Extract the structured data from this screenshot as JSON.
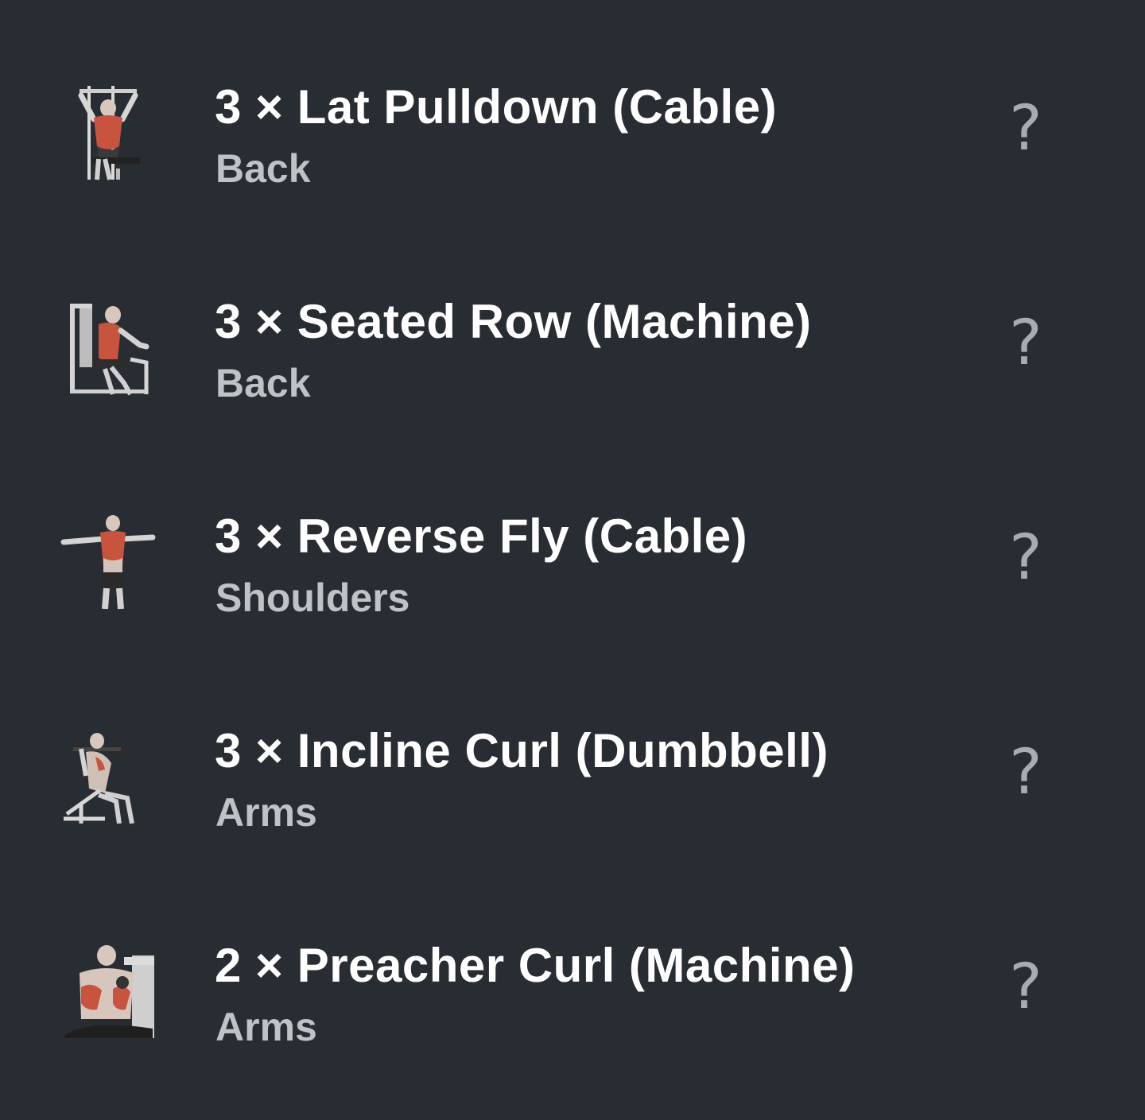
{
  "exercises": [
    {
      "title": "3 × Lat Pulldown (Cable)",
      "muscle": "Back",
      "help_icon": "question-mark",
      "help_glyph": "?"
    },
    {
      "title": "3 × Seated Row (Machine)",
      "muscle": "Back",
      "help_icon": "question-mark",
      "help_glyph": "?"
    },
    {
      "title": "3 × Reverse Fly (Cable)",
      "muscle": "Shoulders",
      "help_icon": "question-mark",
      "help_glyph": "?"
    },
    {
      "title": "3 × Incline Curl (Dumbbell)",
      "muscle": "Arms",
      "help_icon": "question-mark",
      "help_glyph": "?"
    },
    {
      "title": "2 × Preacher Curl (Machine)",
      "muscle": "Arms",
      "help_icon": "question-mark",
      "help_glyph": "?"
    }
  ],
  "colors": {
    "background": "#282d33",
    "title": "#ffffff",
    "muscle": "#bfc2c6",
    "help_icon": "#a8acb1",
    "muscle_highlight": "#c8533f"
  }
}
